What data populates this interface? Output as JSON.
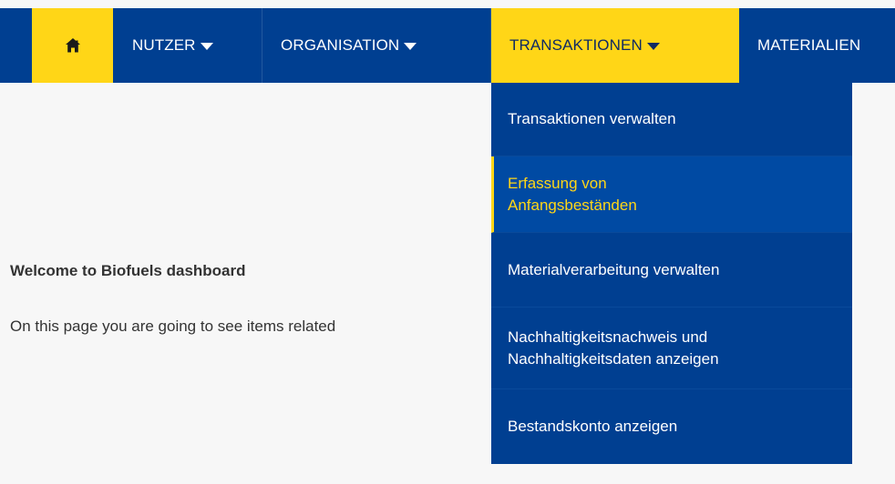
{
  "nav": {
    "home_icon": "home-icon",
    "items": [
      {
        "label": "NUTZER"
      },
      {
        "label": "ORGANISATION"
      },
      {
        "label": "TRANSAKTIONEN"
      },
      {
        "label": "MATERIALIEN"
      }
    ],
    "active_index": 2
  },
  "dropdown": {
    "items": [
      {
        "label": "Transaktionen verwalten"
      },
      {
        "label": "Erfassung von Anfangsbeständen"
      },
      {
        "label": "Materialverarbeitung verwalten"
      },
      {
        "label": "Nachhaltigkeitsnachweis und Nachhaltigkeitsdaten anzeigen"
      },
      {
        "label": "Bestandskonto anzeigen"
      }
    ],
    "hovered_index": 1
  },
  "main": {
    "welcome_title": "Welcome to Biofuels dashboard",
    "description": "On this page you are going to see items related"
  },
  "colors": {
    "nav_blue": "#003f91",
    "accent_yellow": "#ffd617",
    "text_dark": "#333333"
  }
}
